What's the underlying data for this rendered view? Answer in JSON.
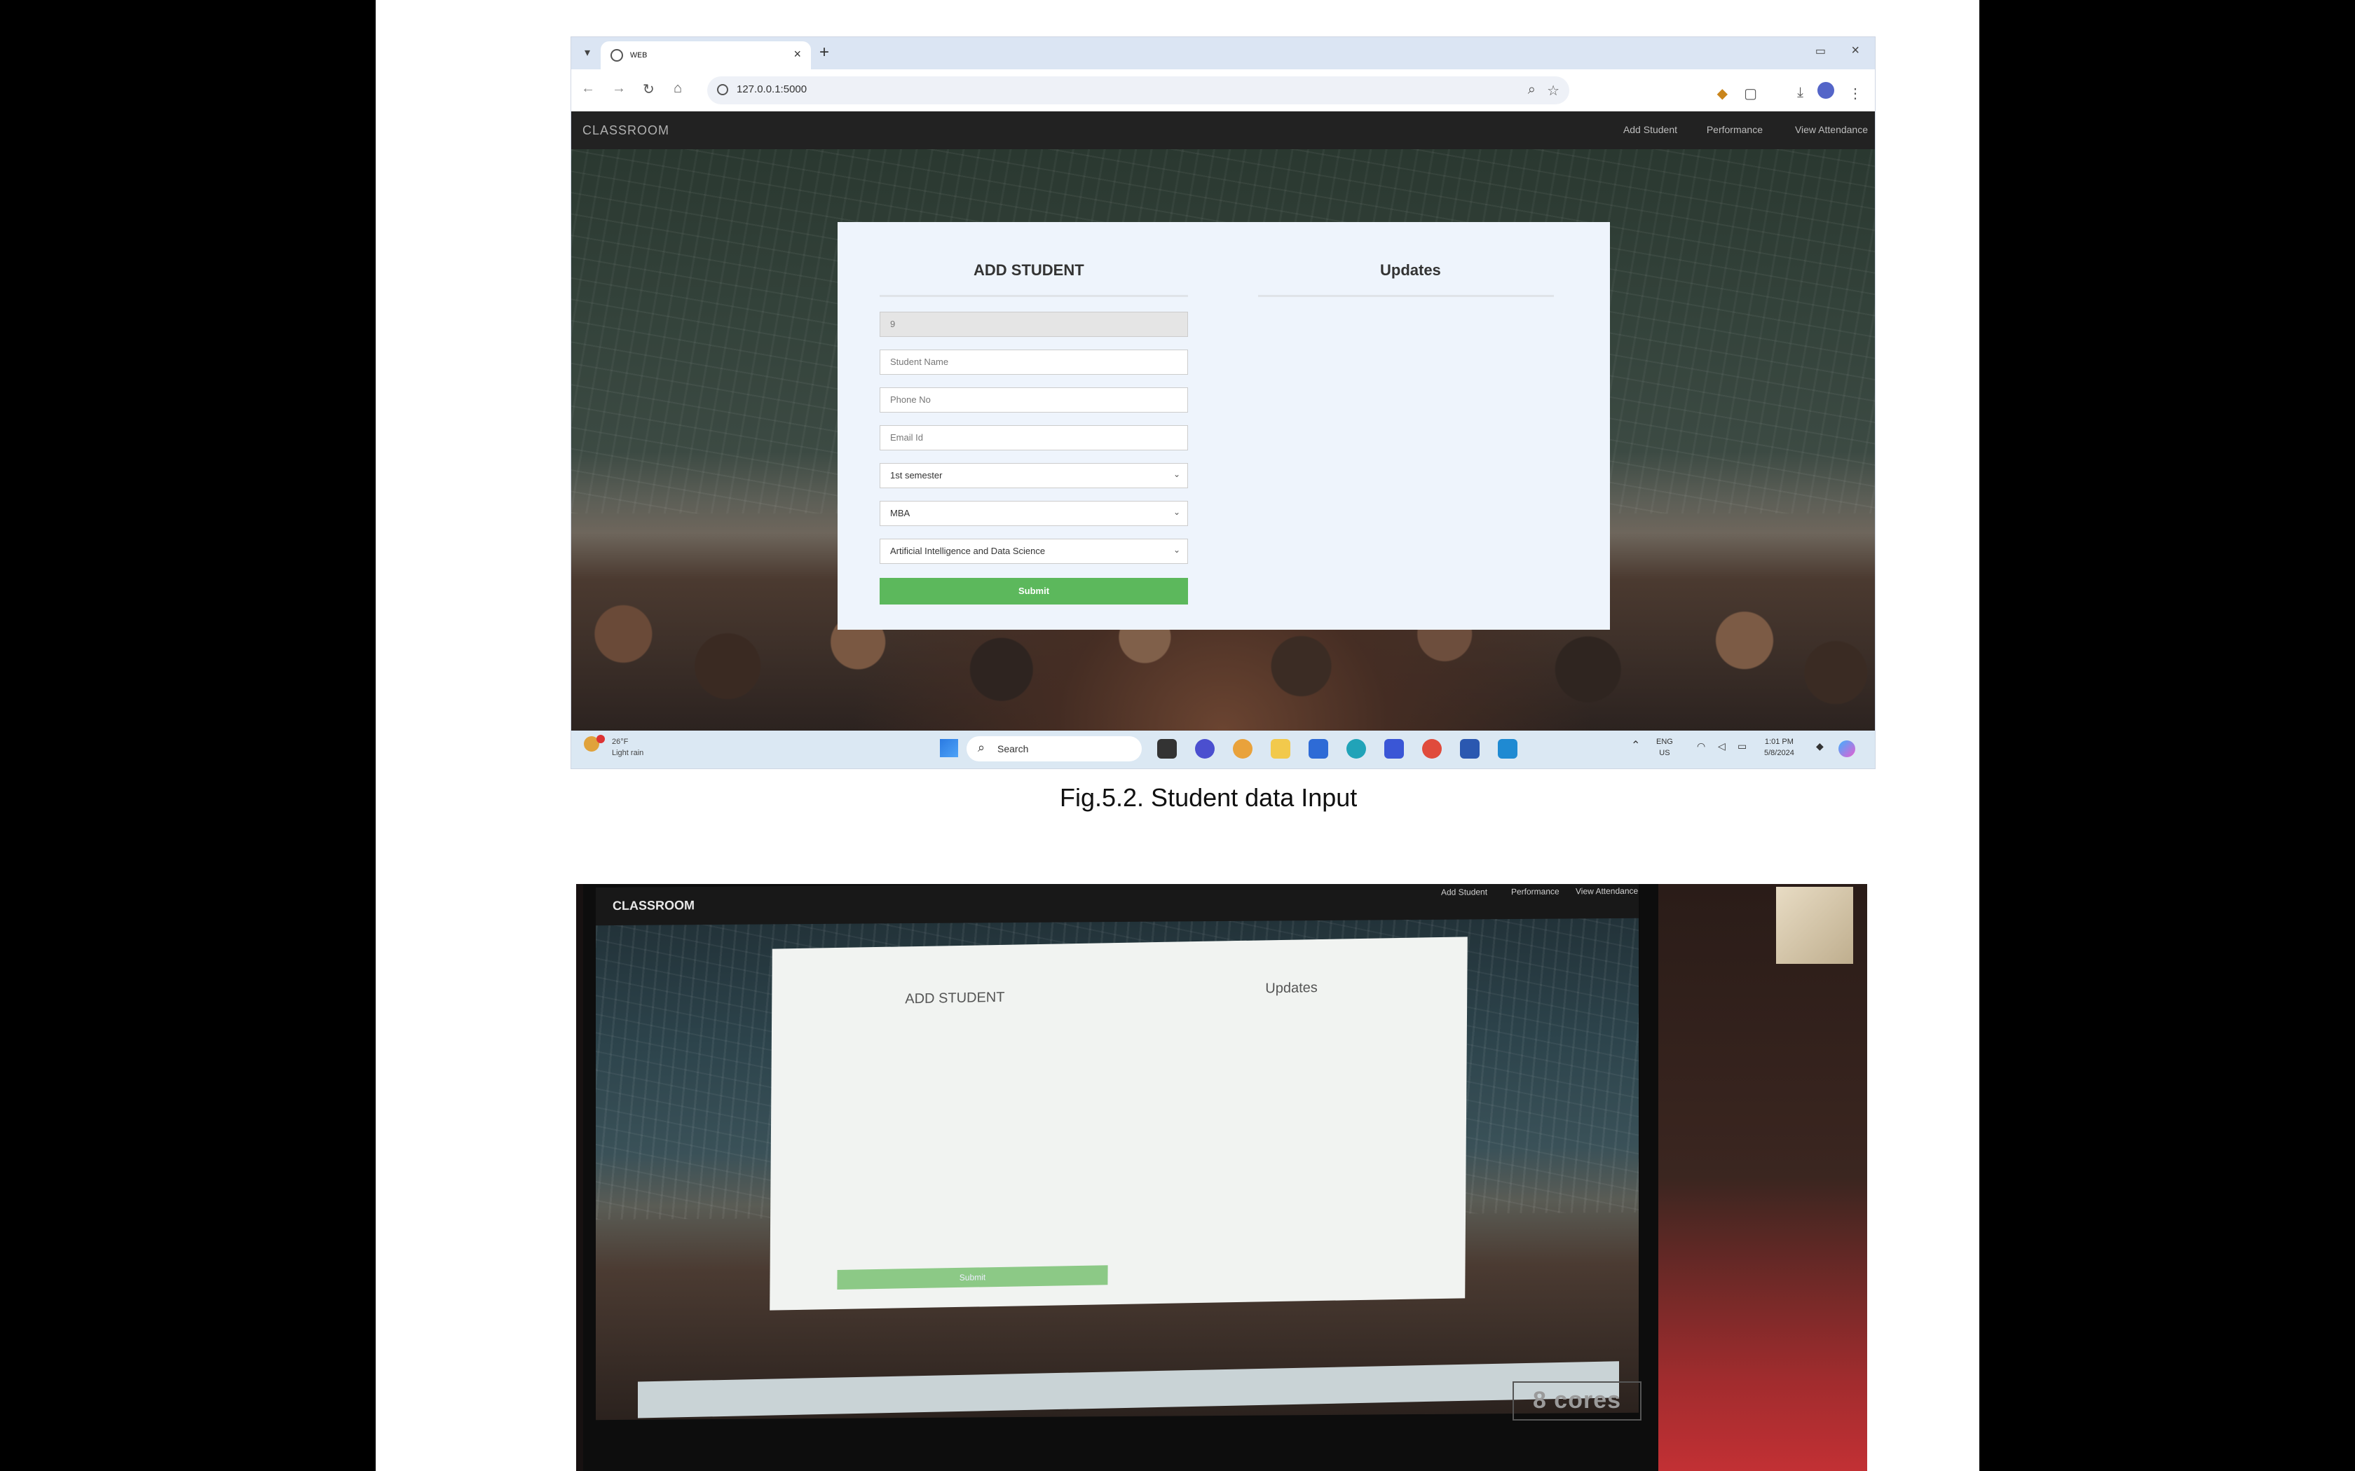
{
  "browser": {
    "tab_title": "ᴡᴇʙ",
    "url": "127.0.0.1:5000"
  },
  "app": {
    "brand": "CLASSROOM",
    "nav": [
      "Add Student",
      "Performance",
      "View Attendance"
    ]
  },
  "form": {
    "title": "ADD STUDENT",
    "updates_title": "Updates",
    "id_value": "9",
    "name_placeholder": "Student Name",
    "phone_placeholder": "Phone No",
    "email_placeholder": "Email Id",
    "semester": "1st semester",
    "program": "MBA",
    "department": "Artificial Intelligence and Data Science",
    "submit": "Submit"
  },
  "taskbar": {
    "weather_line1": "26°F",
    "weather_line2": "Light rain",
    "search": "Search",
    "lang": "ENG",
    "lang2": "US",
    "time": "1:01 PM",
    "date": "5/8/2024"
  },
  "caption": "Fig.5.2. Student data Input",
  "photo": {
    "brand": "CLASSROOM",
    "nav": [
      "Add Student",
      "Performance",
      "View Attendance"
    ],
    "form_title": "ADD STUDENT",
    "updates_title": "Updates",
    "submit": "Submit",
    "monitor_label": "8 cores"
  }
}
